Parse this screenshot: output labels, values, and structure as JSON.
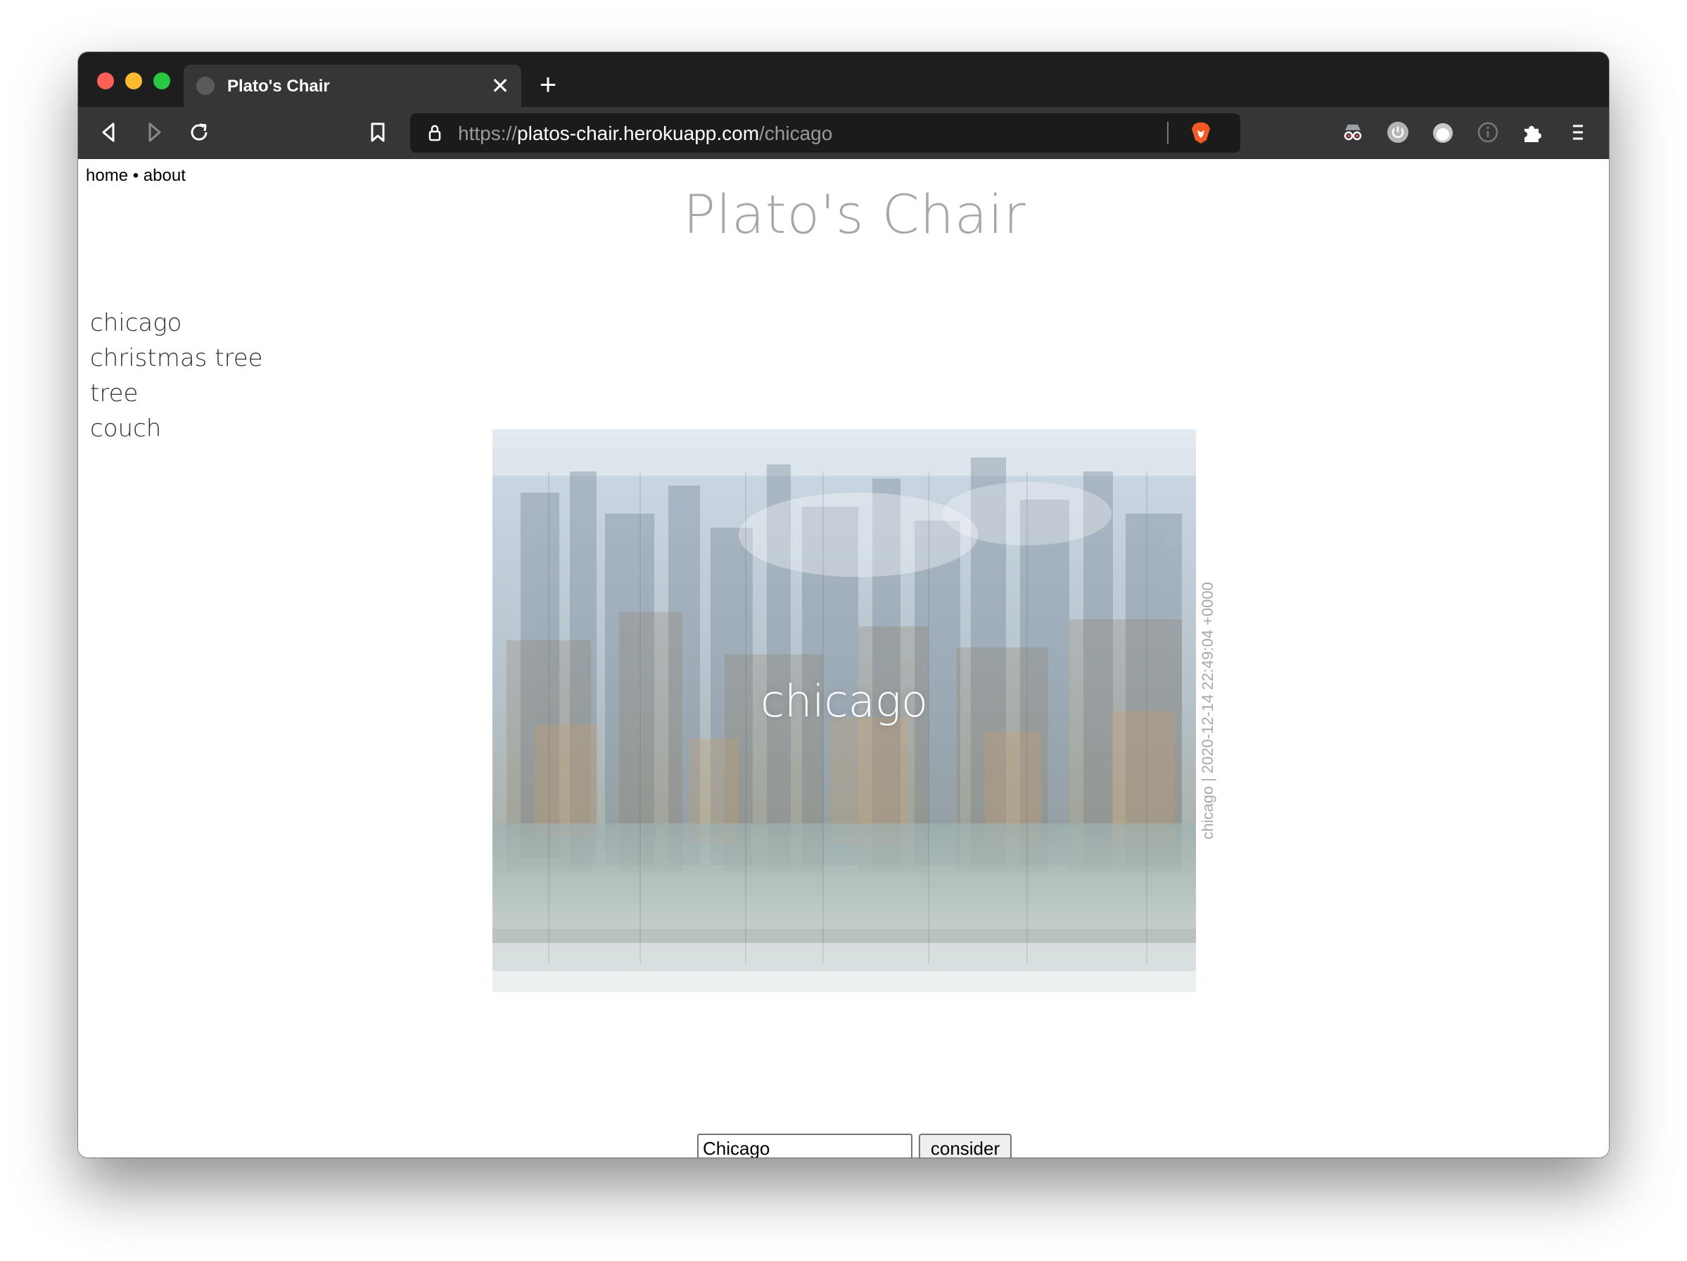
{
  "browser": {
    "tab_title": "Plato's Chair",
    "url_scheme": "https://",
    "url_host": "platos-chair.herokuapp.com",
    "url_path": "/chicago"
  },
  "nav": {
    "home": "home",
    "separator": " • ",
    "about": "about"
  },
  "page": {
    "title": "Plato's Chair"
  },
  "sidebar": {
    "items": [
      "chicago",
      "christmas tree",
      "tree",
      "couch"
    ]
  },
  "composite": {
    "label": "chicago",
    "caption": "chicago | 2020-12-14 22:49:04 +0000"
  },
  "form": {
    "query_value": "Chicago",
    "submit_label": "consider"
  },
  "colors": {
    "title_gray": "#a7a7a7",
    "browser_dark": "#1e1e1e",
    "toolbar": "#363636"
  }
}
